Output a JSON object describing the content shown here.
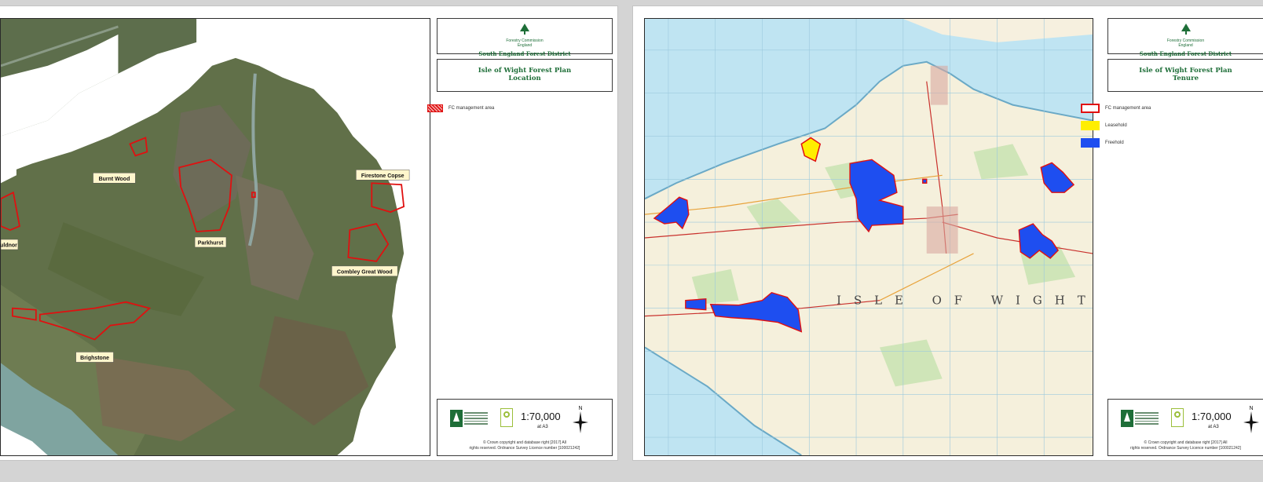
{
  "left_sheet": {
    "fc_org": "Forestry Commission",
    "fc_sub": "England",
    "district": "South England Forest District",
    "title_line1": "Isle of Wight Forest Plan",
    "title_line2": "Location",
    "legend": [
      {
        "label": "FC management area",
        "swatch": "red-hatch"
      }
    ],
    "sites": [
      "Burnt Wood",
      "Firestone Copse",
      "Parkhurst",
      "Combley Great Wood",
      "Brighstone",
      "uldnor"
    ],
    "scale": "1:70,000",
    "scale_sub": "at A3",
    "north": "N",
    "copyright_line1": "© Crown copyright and database right [2017] All",
    "copyright_line2": "rights reserved. Ordnance Survey Licence number [100021242]"
  },
  "right_sheet": {
    "fc_org": "Forestry Commission",
    "fc_sub": "England",
    "district": "South England Forest District",
    "title_line1": "Isle of Wight Forest Plan",
    "title_line2": "Tenure",
    "legend": [
      {
        "label": "FC management area",
        "swatch": "red-outline"
      },
      {
        "label": "Leasehold",
        "swatch": "yellow"
      },
      {
        "label": "Freehold",
        "swatch": "blue"
      }
    ],
    "map_text": "ISLE OF WIGHT",
    "scale": "1:70,000",
    "scale_sub": "at A3",
    "north": "N",
    "copyright_line1": "© Crown copyright and database right [2017] All",
    "copyright_line2": "rights reserved. Ordnance Survey Licence number [100021242]"
  },
  "colors": {
    "fc_green": "#1e6e38",
    "boundary_red": "#e01010",
    "leasehold_yellow": "#ffee00",
    "freehold_blue": "#1e4ef0"
  }
}
